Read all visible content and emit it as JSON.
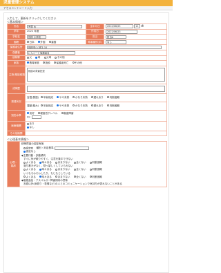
{
  "app_title": "児童管理システム",
  "page_subtitle": "アセスメントシート入力",
  "intro": "入力して、更新をクリックしてください",
  "section_basic": "＜基本情報＞",
  "section_psych": "＜心理基本情報＞",
  "fields": {
    "name_label": "氏名",
    "name_value": "児童 太",
    "birth_label": "生年月日",
    "birth_value": "2010/06/25",
    "age_value": "11",
    "age_unit": "歳",
    "grade_label": "学年",
    "grade_value": "2022 年度",
    "entry_date_label": "作成日",
    "entry_date_value": "2022/06/23",
    "school_label": "学校名",
    "school_value": "別府 小学校",
    "school_select": "小学校",
    "worker_label": "担当",
    "worker_value": "担当A",
    "nationality_label": "国籍",
    "nationality_options": [
      "日本",
      "外国",
      "重国"
    ],
    "nationality_selected": 1,
    "disability_label": "障害種別(手)",
    "disability_value": "なし",
    "address_label": "保護者住所",
    "address_value": "別府市○○町1-10",
    "guardian_label": "保護者",
    "guardian_value": "にんぐ一と保護者名",
    "relation_label": "続柄等",
    "relation_options": [
      "父",
      "母",
      "父母",
      "その他"
    ],
    "relation_selected": 1,
    "family_label": "家族",
    "family_options": [
      "養育家庭",
      "施設",
      "保護者死亡",
      "その他"
    ],
    "family_selected": 0,
    "main_complaint_label": "主訴(相談経路)",
    "main_complaint_value": "相談の背景記述",
    "history_label": "成育歴",
    "development_label": "発達状況",
    "dev_row1_label": "言語(発語)",
    "dev_row2_label": "運動(粗大)",
    "dev_options": [
      "年齢相応",
      "やや未熟",
      "かなり未熟",
      "遅れあり",
      "判断困難"
    ],
    "dev_row1_selected": 1,
    "dev_row2_selected": 1,
    "iq_label": "知的水準",
    "iq_options": [
      "良好",
      "軽度低下レベル",
      "高度障害"
    ],
    "iq_selected": 0,
    "iq_prefix": "IQ：",
    "medical_label": "医療機関",
    "medical_options": [
      "あり",
      "なし"
    ],
    "medical_selected": 1,
    "other_label": "その他機関"
  },
  "psych": {
    "side_label": "心理・臨床",
    "title1": "精神障害の認定有無",
    "cert_opt1": "認定有",
    "cert_opt1_detail": "種別・判定基準",
    "cert_opt2": "認定なし",
    "q1": "◆主要行動・多動傾向",
    "q1_sub": "すぐに気が散りやすく、注意を集中できない",
    "q2": "落ち着きがなく、黙っ望しくしていられない",
    "q3": "いつもそわそわしたり、もじもじしている",
    "scale": [
      "よくある",
      "時々ある",
      "あまりない",
      "全くない",
      "判断困難"
    ],
    "q1_selected": 1,
    "q2_selected": 1,
    "q3_selected": 1,
    "q4": "◆複雑会話・アスペルガー障害傾向の意味",
    "q4_sub": "言語以外(身振り・表情など)の人とのコミュニケーションで気持ちが表れないことがある"
  },
  "colors": {
    "accent": "#f3b23c",
    "label_bg": "#e97d5b",
    "border": "#f2b8a6",
    "radio_on": "#1a73e8"
  }
}
